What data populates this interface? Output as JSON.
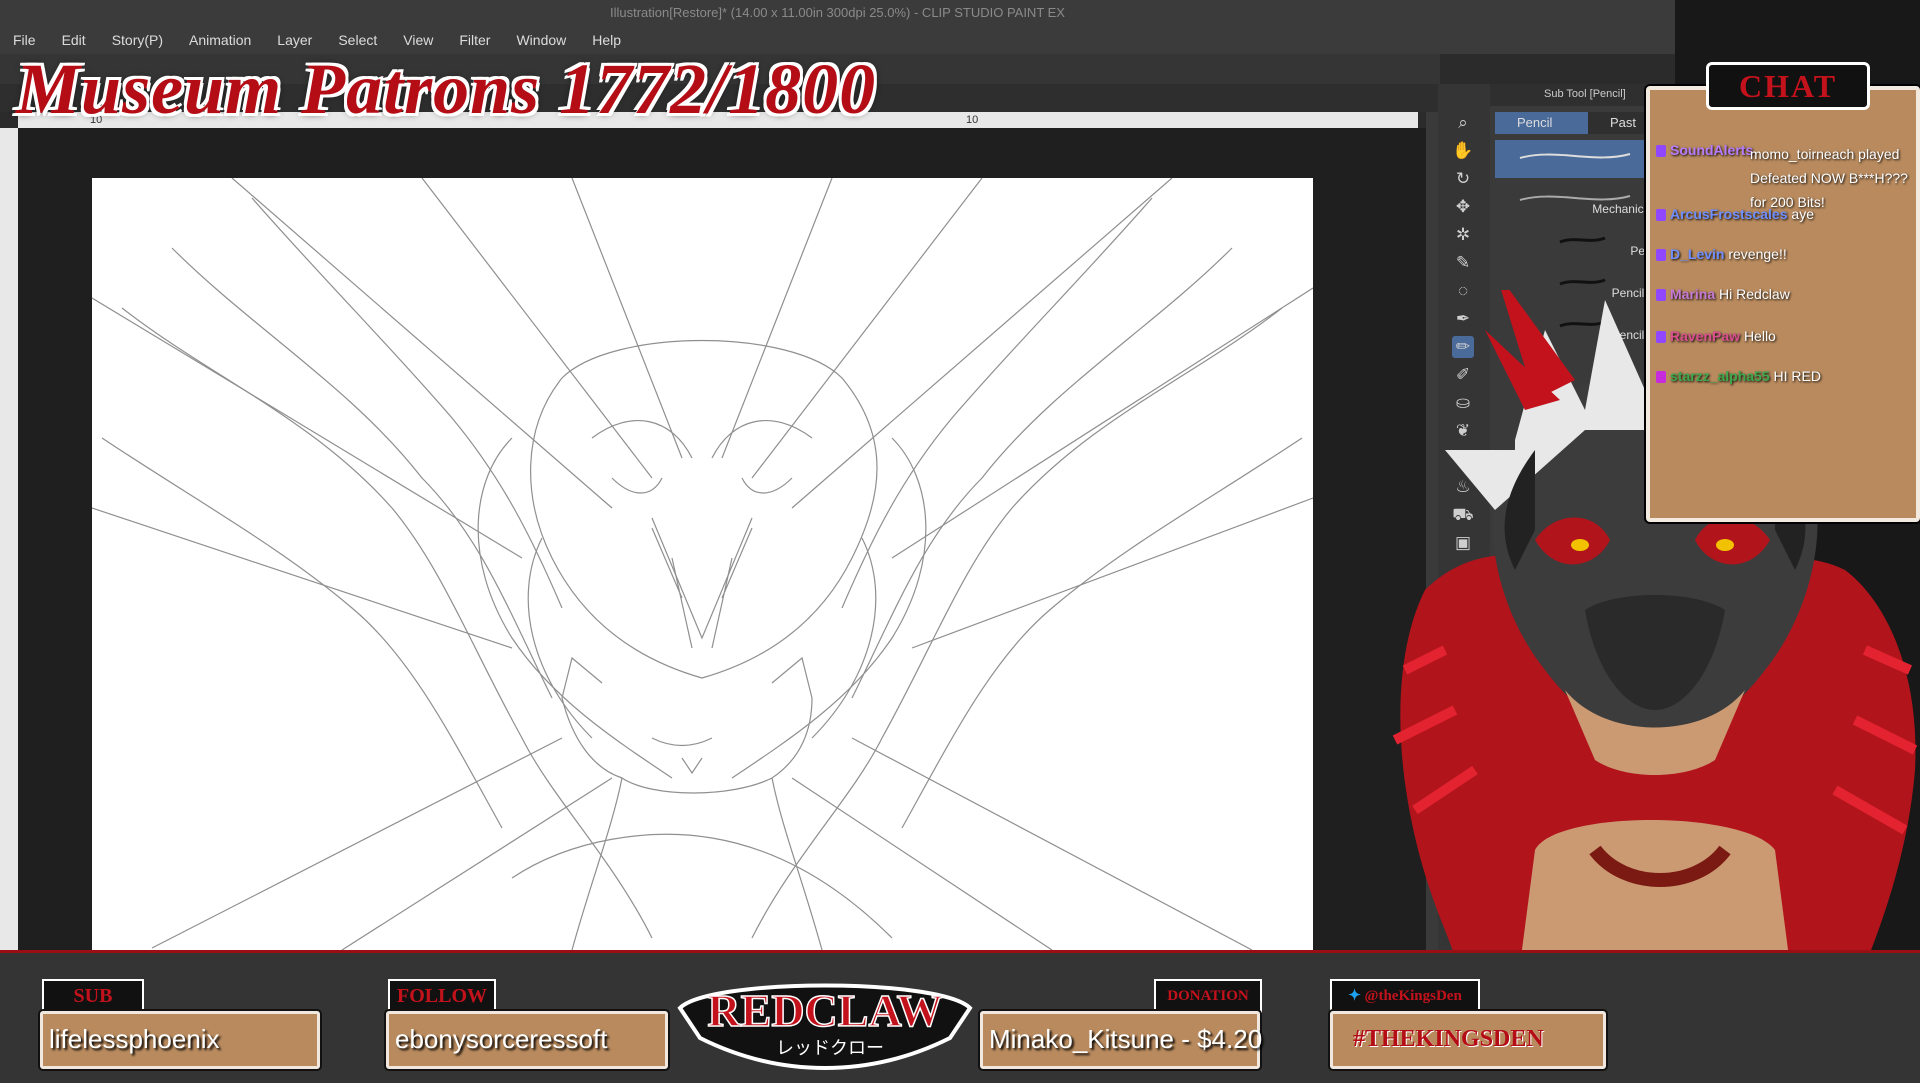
{
  "app": {
    "window_title": "Illustration[Restore]* (14.00 x 11.00in 300dpi 25.0%) - CLIP STUDIO PAINT EX"
  },
  "menu": {
    "items": [
      "File",
      "Edit",
      "Story(P)",
      "Animation",
      "Layer",
      "Select",
      "View",
      "Filter",
      "Window",
      "Help"
    ]
  },
  "ruler": {
    "ticks": [
      "10",
      "10"
    ]
  },
  "subtool_panel": {
    "header": "Sub Tool [Pencil]",
    "tabs": [
      "Pencil",
      "Past"
    ],
    "brushes": [
      "Mechanical p",
      "Pencil",
      "Pencil - S",
      "Pencil - B"
    ]
  },
  "overlay": {
    "title": "Museum Patrons 1772/1800"
  },
  "chat": {
    "title": "CHAT",
    "messages": [
      {
        "user": "SoundAlerts",
        "text": "momo_toirneach played Defeated NOW B***H??? for 200 Bits!",
        "badge_color": "#9146ff"
      },
      {
        "user": "ArcusFrostscales",
        "text": "aye",
        "badge_color": "#9146ff"
      },
      {
        "user": "D_Levin",
        "text": "revenge!!",
        "badge_color": "#9146ff"
      },
      {
        "user": "Marina",
        "text": "Hi Redclaw",
        "badge_color": "#9146ff"
      },
      {
        "user": "RavenPaw",
        "text": "Hello",
        "badge_color": "#9146ff"
      },
      {
        "user": "starzz_alpha55",
        "text": "HI RED",
        "badge_color": "#c72bde"
      }
    ]
  },
  "bottom": {
    "sub_tag": "SUB",
    "sub_name": "lifelessphoenix",
    "follow_tag": "FOLLOW",
    "follow_name": "ebonysorceressoft",
    "logo_text": "REDCLAW",
    "logo_sub": "レッドクロー",
    "donation_tag": "DONATION",
    "donation_text": "Minako_Kitsune - $4.20",
    "twitter_tag": "@theKingsDen",
    "twitter_hashtag": "#THEKINGSDEN"
  },
  "colors": {
    "accent_red": "#b50d16",
    "card_tan": "#b88a5e",
    "ui_dark": "#353535"
  }
}
